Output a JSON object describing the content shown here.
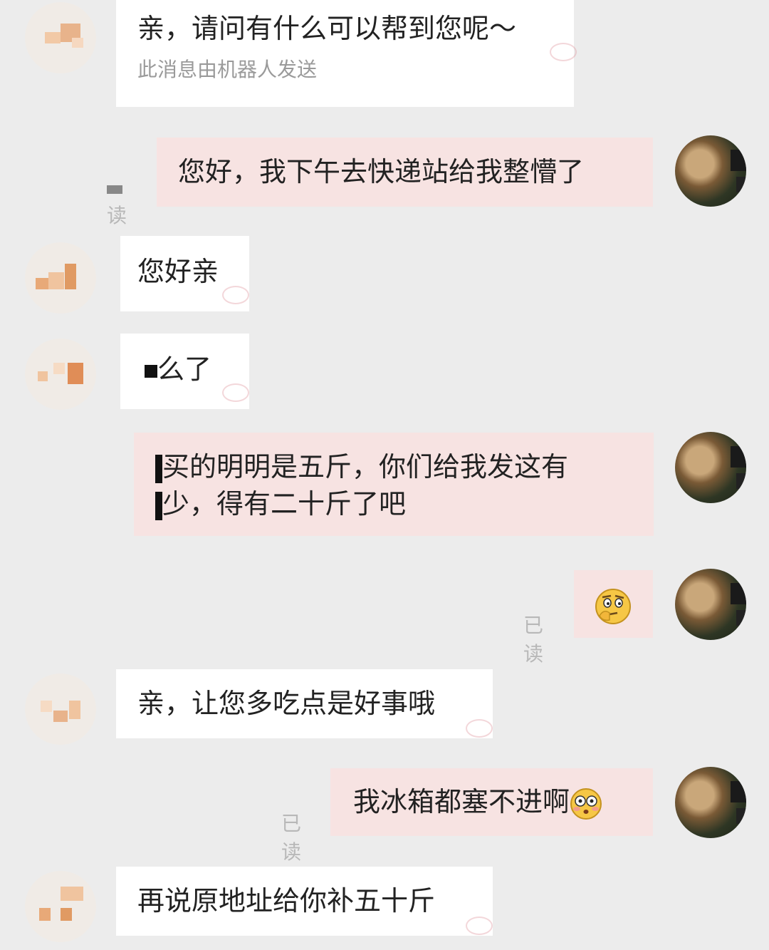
{
  "messages": [
    {
      "from": "agent",
      "text": "亲，请问有什么可以帮到您呢～",
      "note": "此消息由机器人发送"
    },
    {
      "from": "user",
      "text": "您好，我下午去快递站给我整懵了",
      "status": "已读"
    },
    {
      "from": "agent",
      "text": "您好亲"
    },
    {
      "from": "agent",
      "text": "么了"
    },
    {
      "from": "user",
      "line1": "买的明明是五斤，你们给我发这有",
      "line2": "少，得有二十斤了吧"
    },
    {
      "from": "user",
      "status": "已读",
      "emoji": "thinking-face-emoji"
    },
    {
      "from": "agent",
      "text": "亲，让您多吃点是好事哦"
    },
    {
      "from": "user",
      "text": "我冰箱都塞不进啊",
      "status": "已读",
      "emoji": "flushed-face-emoji"
    },
    {
      "from": "agent",
      "text": "再说原地址给你补五十斤"
    }
  ],
  "colors": {
    "background": "#ececec",
    "incoming": "#ffffff",
    "outgoing": "#f7e3e2",
    "status": "#b8b8b8"
  }
}
